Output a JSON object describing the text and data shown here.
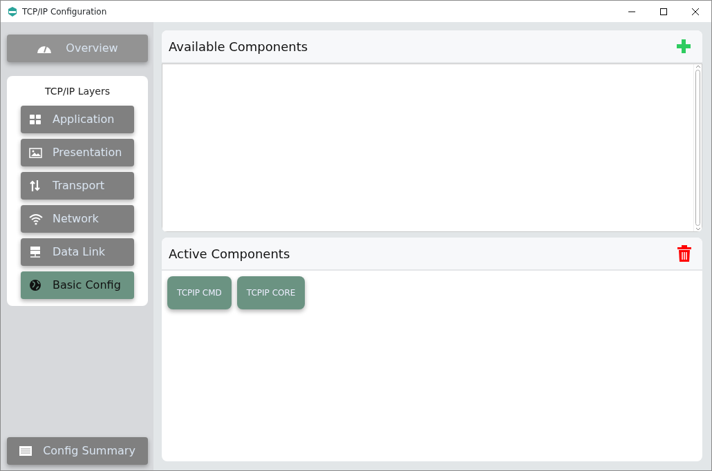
{
  "window": {
    "title": "TCP/IP Configuration"
  },
  "sidebar": {
    "overview": "Overview",
    "layers_title": "TCP/IP Layers",
    "layers": [
      {
        "label": "Application",
        "selected": false
      },
      {
        "label": "Presentation",
        "selected": false
      },
      {
        "label": "Transport",
        "selected": false
      },
      {
        "label": "Network",
        "selected": false
      },
      {
        "label": "Data Link",
        "selected": false
      },
      {
        "label": "Basic Config",
        "selected": true
      }
    ],
    "summary": "Config Summary"
  },
  "available": {
    "title": "Available Components"
  },
  "active": {
    "title": "Active Components",
    "components": [
      "TCPIP CMD",
      "TCPIP CORE"
    ]
  }
}
